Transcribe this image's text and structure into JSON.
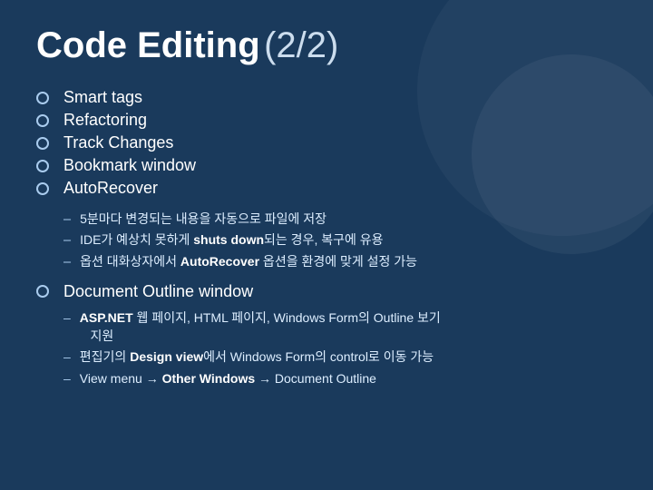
{
  "title": {
    "main": "Code Editing",
    "sub": " (2/2)"
  },
  "bullets": [
    {
      "label": "Smart tags"
    },
    {
      "label": "Refactoring"
    },
    {
      "label": "Track Changes"
    },
    {
      "label": "Bookmark window"
    },
    {
      "label": "AutoRecover"
    }
  ],
  "autorecover_subs": [
    {
      "text": "5분마다 변경되는 내용을 자동으로 파일에 저장"
    },
    {
      "text": "IDE가 예상치 못하게 shuts down되는 경우, 복구에 유용",
      "bold": "shuts down"
    },
    {
      "text": "옵션 대화상자에서 AutoRecover 옵션을 환경에 맞게 설정 가능",
      "bold": "AutoRecover"
    }
  ],
  "section": {
    "label": "Document Outline window",
    "subs": [
      {
        "text": "ASP.NET 웹 페이지, HTML 페이지, Windows Form의 Outline 보기 지원",
        "bold": "ASP.NET"
      },
      {
        "text": "편집기의 Design view에서 Windows Form의 control로 이동 가능",
        "bold": "Design view"
      },
      {
        "text": "View menu → Other Windows → Document Outline",
        "bold": "Other Windows"
      }
    ]
  }
}
